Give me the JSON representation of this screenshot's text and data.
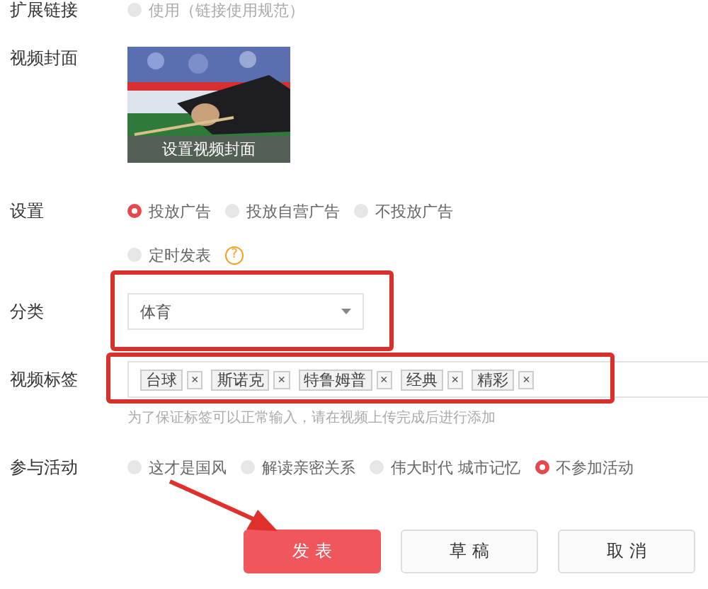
{
  "extend_link": {
    "label": "扩展链接",
    "option": {
      "label": "使用（链接使用规范）",
      "checked": false,
      "disabled": true
    }
  },
  "cover": {
    "label": "视频封面",
    "button": "设置视频封面"
  },
  "settings": {
    "label": "设置",
    "ads": [
      {
        "label": "投放广告",
        "selected": true
      },
      {
        "label": "投放自营广告",
        "selected": false
      },
      {
        "label": "不投放广告",
        "selected": false
      }
    ],
    "schedule": {
      "label": "定时发表",
      "checked": false,
      "help": "?"
    }
  },
  "category": {
    "label": "分类",
    "value": "体育"
  },
  "tags": {
    "label": "视频标签",
    "items": [
      {
        "text": "台球",
        "remove": "×"
      },
      {
        "text": "斯诺克",
        "remove": "×"
      },
      {
        "text": "特鲁姆普",
        "remove": "×"
      },
      {
        "text": "经典",
        "remove": "×"
      },
      {
        "text": "精彩",
        "remove": "×"
      }
    ],
    "hint": "为了保证标签可以正常输入，请在视频上传完成后进行添加"
  },
  "activity": {
    "label": "参与活动",
    "options": [
      {
        "label": "这才是国风",
        "selected": false
      },
      {
        "label": "解读亲密关系",
        "selected": false
      },
      {
        "label": "伟大时代 城市记忆",
        "selected": false
      },
      {
        "label": "不参加活动",
        "selected": true
      }
    ]
  },
  "buttons": [
    {
      "label": "发 表",
      "kind": "primary"
    },
    {
      "label": "草 稿",
      "kind": "default"
    },
    {
      "label": "取 消",
      "kind": "default"
    }
  ]
}
